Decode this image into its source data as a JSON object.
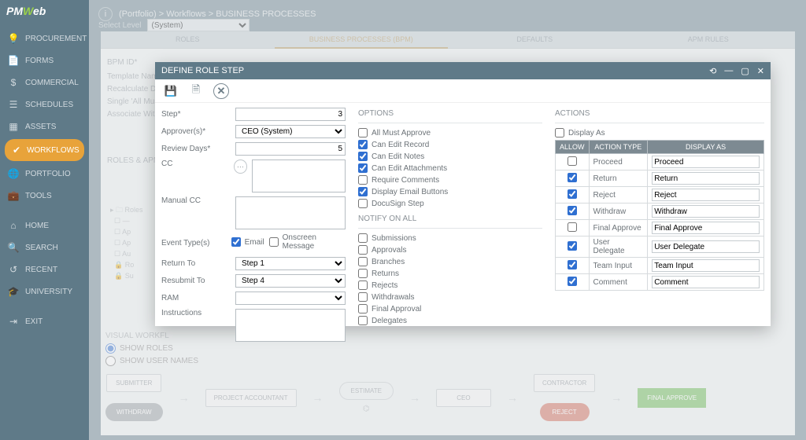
{
  "brand": {
    "pm": "PM",
    "w": "W",
    "eb": "eb"
  },
  "breadcrumb": "(Portfolio) > Workflows > BUSINESS PROCESSES",
  "level": {
    "label": "Select Level",
    "value": "(System)"
  },
  "sidebar": {
    "items": [
      {
        "icon": "💡",
        "label": "PROCUREMENT"
      },
      {
        "icon": "📄",
        "label": "FORMS"
      },
      {
        "icon": "$",
        "label": "COMMERCIAL"
      },
      {
        "icon": "☰",
        "label": "SCHEDULES"
      },
      {
        "icon": "▦",
        "label": "ASSETS"
      },
      {
        "icon": "✔",
        "label": "WORKFLOWS"
      },
      {
        "icon": "🌐",
        "label": "PORTFOLIO"
      },
      {
        "icon": "💼",
        "label": "TOOLS"
      },
      {
        "icon": "⌂",
        "label": "HOME"
      },
      {
        "icon": "🔍",
        "label": "SEARCH"
      },
      {
        "icon": "↺",
        "label": "RECENT"
      },
      {
        "icon": "🎓",
        "label": "UNIVERSITY"
      },
      {
        "icon": "⇥",
        "label": "EXIT"
      }
    ]
  },
  "bgtabs": {
    "a": "ROLES",
    "b": "BUSINESS PROCESSES (BPM)",
    "c": "DEFAULTS",
    "d": "APM RULES"
  },
  "bg": {
    "bpm_id": "BPM ID*",
    "tpl": "Template Name",
    "recalc": "Recalculate Due",
    "single": "Single 'All Must'",
    "assoc": "Associate With",
    "roles_hdr": "ROLES & APM R",
    "tree_root": "Roles",
    "tree": [
      "—",
      "Ap",
      "Ap",
      "Au",
      "Ro",
      "Su"
    ]
  },
  "dialog": {
    "title": "DEFINE ROLE STEP",
    "labels": {
      "step": "Step*",
      "approver": "Approver(s)*",
      "review": "Review Days*",
      "cc": "CC",
      "manualcc": "Manual CC",
      "eventtype": "Event Type(s)",
      "returnto": "Return To",
      "resubmit": "Resubmit To",
      "ram": "RAM",
      "instructions": "Instructions"
    },
    "values": {
      "step": "3",
      "approver": "CEO (System)",
      "review": "5",
      "returnto": "Step 1",
      "resubmit": "Step 4",
      "ram": ""
    },
    "event_email": "Email",
    "event_onscreen": "Onscreen Message",
    "options_title": "OPTIONS",
    "options": [
      {
        "label": "All Must Approve",
        "checked": false
      },
      {
        "label": "Can Edit Record",
        "checked": true
      },
      {
        "label": "Can Edit Notes",
        "checked": true
      },
      {
        "label": "Can Edit Attachments",
        "checked": true
      },
      {
        "label": "Require Comments",
        "checked": false
      },
      {
        "label": "Display Email Buttons",
        "checked": true
      },
      {
        "label": "DocuSign Step",
        "checked": false
      }
    ],
    "notify_title": "NOTIFY ON ALL",
    "notify": [
      {
        "label": "Submissions",
        "checked": false
      },
      {
        "label": "Approvals",
        "checked": false
      },
      {
        "label": "Branches",
        "checked": false
      },
      {
        "label": "Returns",
        "checked": false
      },
      {
        "label": "Rejects",
        "checked": false
      },
      {
        "label": "Withdrawals",
        "checked": false
      },
      {
        "label": "Final Approval",
        "checked": false
      },
      {
        "label": "Delegates",
        "checked": false
      }
    ],
    "actions_title": "ACTIONS",
    "display_as_chk": "Display As",
    "atable_headers": {
      "allow": "ALLOW",
      "type": "ACTION TYPE",
      "display": "DISPLAY AS"
    },
    "actions": [
      {
        "allow": false,
        "type": "Proceed",
        "display": "Proceed"
      },
      {
        "allow": true,
        "type": "Return",
        "display": "Return"
      },
      {
        "allow": true,
        "type": "Reject",
        "display": "Reject"
      },
      {
        "allow": true,
        "type": "Withdraw",
        "display": "Withdraw"
      },
      {
        "allow": false,
        "type": "Final Approve",
        "display": "Final Approve"
      },
      {
        "allow": true,
        "type": "User Delegate",
        "display": "User Delegate"
      },
      {
        "allow": true,
        "type": "Team Input",
        "display": "Team Input"
      },
      {
        "allow": true,
        "type": "Comment",
        "display": "Comment"
      }
    ]
  },
  "vw": {
    "title": "VISUAL WORKFL",
    "show_roles": "SHOW ROLES",
    "show_users": "SHOW USER NAMES",
    "nodes": {
      "submitter": "SUBMITTER",
      "pa": "PROJECT ACCOUNTANT",
      "est": "ESTIMATE",
      "ceo": "CEO",
      "con": "CONTRACTOR",
      "approve": "FINAL APPROVE",
      "withdraw": "WITHDRAW",
      "reject": "REJECT"
    }
  }
}
